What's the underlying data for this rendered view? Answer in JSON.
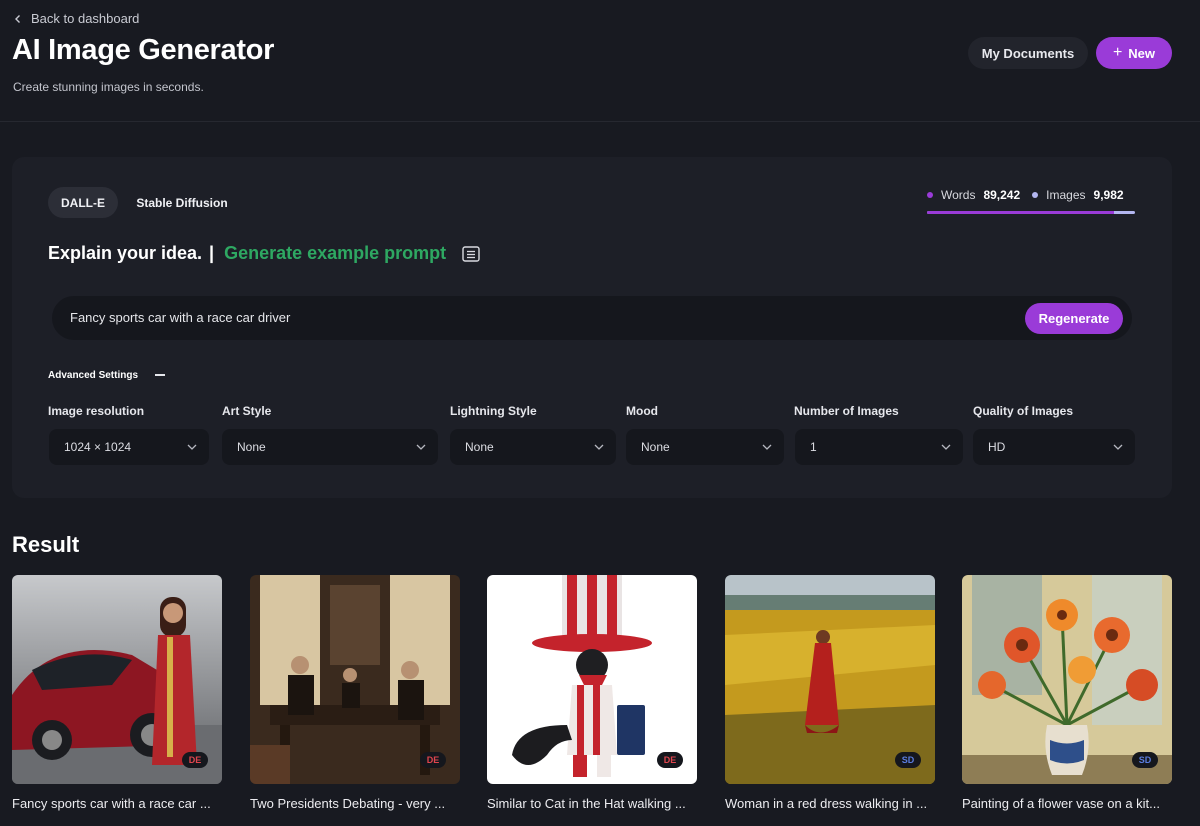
{
  "header": {
    "back_label": "Back to dashboard",
    "title": "AI Image Generator",
    "subtitle": "Create stunning images in seconds.",
    "docs_label": "My Documents",
    "new_label": "New"
  },
  "generator": {
    "tabs": [
      {
        "label": "DALL-E",
        "active": true
      },
      {
        "label": "Stable Diffusion",
        "active": false
      }
    ],
    "usage": {
      "words_label": "Words",
      "words_value": "89,242",
      "images_label": "Images",
      "images_value": "9,982",
      "words_color": "#9a3bd8",
      "images_color": "#b3b6f0",
      "words_share": 0.9
    },
    "idea_label": "Explain your idea.",
    "idea_separator": "|",
    "generate_example_label": "Generate example prompt",
    "prompt_value": "Fancy sports car with a race car driver",
    "regenerate_label": "Regenerate",
    "advanced_label": "Advanced Settings",
    "settings": [
      {
        "label": "Image resolution",
        "value": "1024 × 1024"
      },
      {
        "label": "Art Style",
        "value": "None"
      },
      {
        "label": "Lightning Style",
        "value": "None"
      },
      {
        "label": "Mood",
        "value": "None"
      },
      {
        "label": "Number of Images",
        "value": "1"
      },
      {
        "label": "Quality of Images",
        "value": "HD"
      }
    ]
  },
  "results": {
    "title": "Result",
    "items": [
      {
        "caption": "Fancy sports car with a race car ...",
        "badge": "DE",
        "badge_color": "#e0454e"
      },
      {
        "caption": "Two Presidents Debating - very ...",
        "badge": "DE",
        "badge_color": "#e0454e"
      },
      {
        "caption": "Similar to Cat in the Hat walking ...",
        "badge": "DE",
        "badge_color": "#e0454e"
      },
      {
        "caption": "Woman in a red dress walking in ...",
        "badge": "SD",
        "badge_color": "#5b7de0"
      },
      {
        "caption": "Painting of a flower vase on a kit...",
        "badge": "SD",
        "badge_color": "#5b7de0"
      }
    ]
  },
  "colors": {
    "accent": "#9a3bd8",
    "success": "#2ea862",
    "background": "#181a21"
  }
}
